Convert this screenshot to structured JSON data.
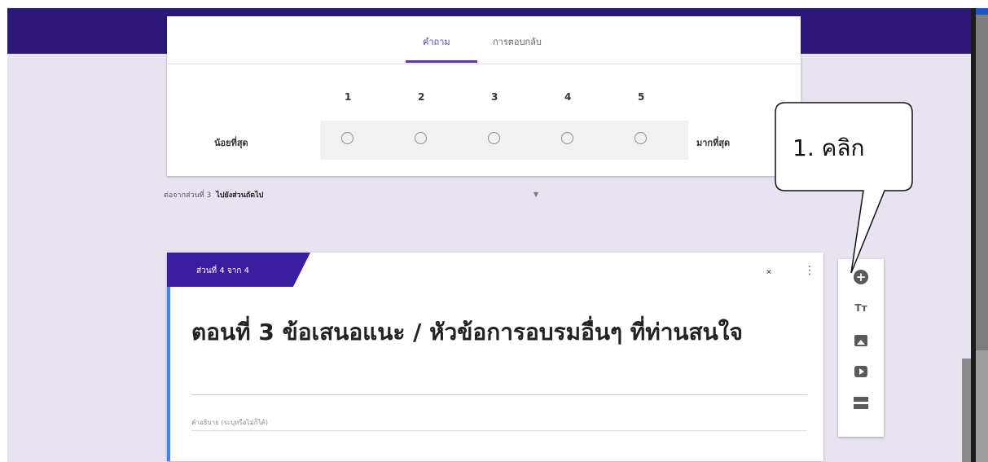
{
  "tabs": [
    {
      "label": "คำถาม"
    },
    {
      "label": "การตอบกลับ"
    }
  ],
  "scale": {
    "numbers": [
      "1",
      "2",
      "3",
      "4",
      "5"
    ],
    "low_label": "น้อยที่สุด",
    "high_label": "มากที่สุด"
  },
  "after_section": {
    "prefix": "ต่อจากส่วนที่ 3",
    "value": "ไปยังส่วนถัดไป"
  },
  "section": {
    "tag": "ส่วนที่ 4 จาก 4",
    "title": "ตอนที่ 3 ข้อเสนอแนะ / หัวข้อการอบรมอื่นๆ ที่ท่านสนใจ",
    "description_placeholder": "คำอธิบาย (ระบุหรือไม่ก็ได้)"
  },
  "toolbar": {
    "title_icon_text": "Tт"
  },
  "callout": {
    "text": "1. คลิก"
  },
  "colors": {
    "header": "#2d187a",
    "accent": "#5e35b1",
    "background": "#e9e2f1",
    "section_edge": "#4285f4"
  },
  "icons": [
    "add-question-icon",
    "add-title-icon",
    "add-image-icon",
    "add-video-icon",
    "add-section-icon",
    "collapse-icon",
    "more-vert-icon"
  ]
}
